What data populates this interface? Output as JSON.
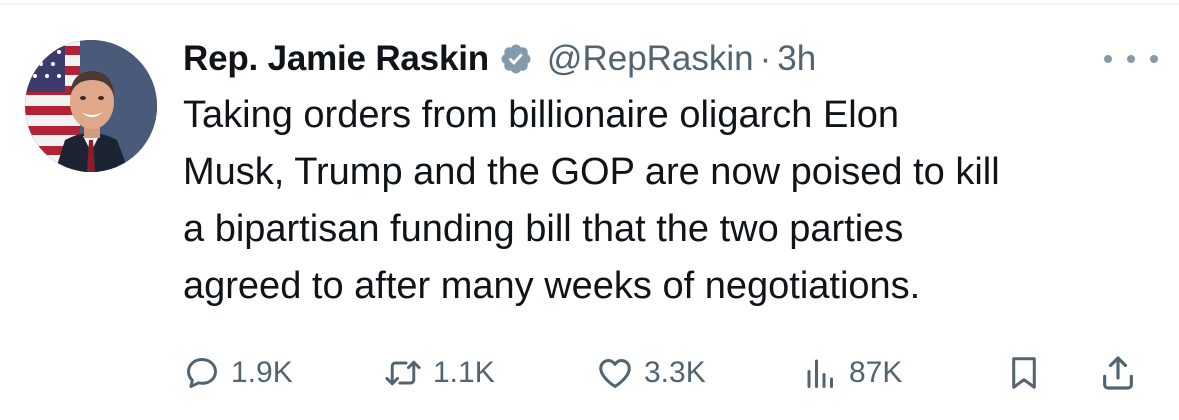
{
  "author": {
    "display_name": "Rep. Jamie Raskin",
    "handle": "@RepRaskin",
    "separator": "·",
    "time": "3h"
  },
  "tweet": {
    "text": "Taking orders from billionaire oligarch Elon\nMusk, Trump and the GOP are now poised to kill\na bipartisan funding bill that the two parties\nagreed to after many weeks of negotiations."
  },
  "metrics": {
    "replies": "1.9K",
    "retweets": "1.1K",
    "likes": "3.3K",
    "views": "87K"
  },
  "icons": {
    "verified": "verified-badge-icon",
    "more": "more-options-icon",
    "reply": "reply-icon",
    "retweet": "retweet-icon",
    "like": "heart-icon",
    "views": "views-chart-icon",
    "bookmark": "bookmark-icon",
    "share": "share-icon"
  },
  "colors": {
    "text": "#0f1419",
    "secondary": "#536471",
    "divider": "#eff3f4",
    "verified_badge": "#829aab"
  }
}
